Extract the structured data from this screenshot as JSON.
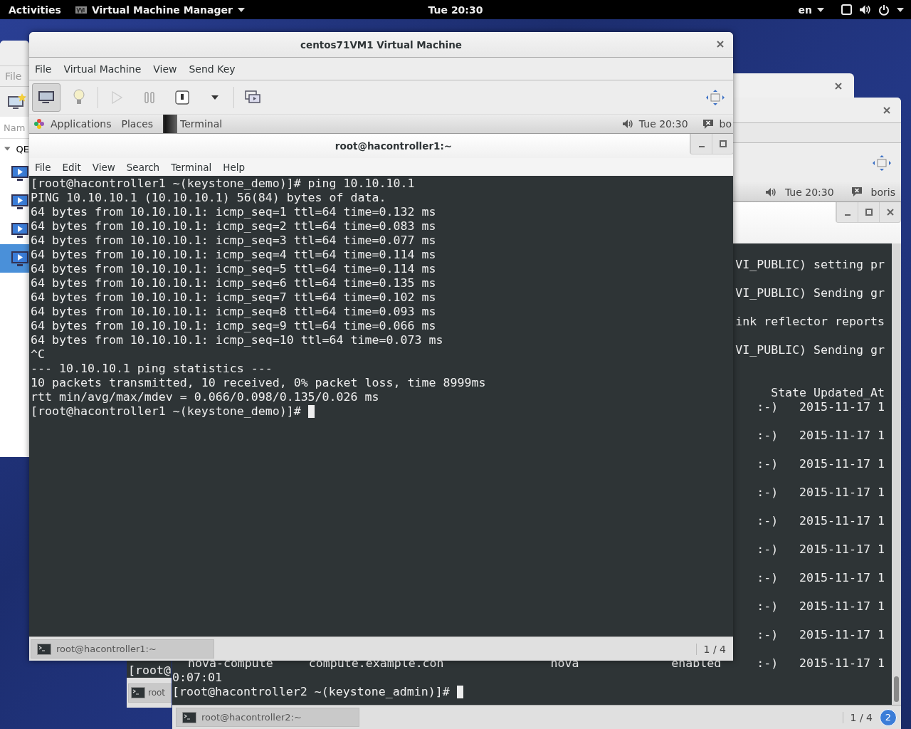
{
  "top_bar": {
    "activities": "Activities",
    "app_menu": "Virtual Machine Manager",
    "clock": "Tue 20:30",
    "input_source": "en"
  },
  "manager_window": {
    "menu": [
      "File"
    ],
    "column_header": "Nam",
    "group": {
      "label": "QE",
      "expanded": true
    },
    "vms": [
      {
        "selected": false
      },
      {
        "selected": false
      },
      {
        "selected": false
      },
      {
        "selected": true
      }
    ]
  },
  "vm_window_2": {
    "guest_panel": {
      "clock": "Tue 20:30",
      "user": "boris"
    },
    "terminal": {
      "lines": [
        {
          "kind": "log",
          "text": "VI_PUBLIC) setting pr"
        },
        {
          "kind": "log",
          "text": "VI_PUBLIC) Sending gr"
        },
        {
          "kind": "log",
          "text": "ink reflector reports"
        },
        {
          "kind": "log",
          "text": "VI_PUBLIC) Sending gr"
        },
        {
          "kind": "header",
          "text": "State Updated_At"
        },
        {
          "kind": "row",
          "text": ":-)   2015-11-17 1"
        },
        {
          "kind": "row",
          "text": ":-)   2015-11-17 1"
        },
        {
          "kind": "row",
          "text": ":-)   2015-11-17 1"
        },
        {
          "kind": "row",
          "text": ":-)   2015-11-17 1"
        },
        {
          "kind": "row",
          "text": ":-)   2015-11-17 1"
        },
        {
          "kind": "row",
          "text": ":-)   2015-11-17 1"
        },
        {
          "kind": "row",
          "text": ":-)   2015-11-17 1"
        },
        {
          "kind": "row",
          "text": ":-)   2015-11-17 1"
        },
        {
          "kind": "row",
          "text": ":-)   2015-11-17 1"
        },
        {
          "kind": "wide",
          "text": "nova-compute     compute.example.con               nova             enabled     :-)   2015-11-17 1"
        },
        {
          "kind": "plain",
          "text": "0:07:01"
        }
      ],
      "prompt": "[root@hacontroller2 ~(keystone_admin)]# "
    },
    "taskbar": {
      "item": "root@hacontroller2:~",
      "workspace": "1 / 4",
      "badge": "2"
    }
  },
  "vm_window_3": {
    "terminal_line": "[root@",
    "taskbar_item": "root"
  },
  "vm_window_1": {
    "title": "centos71VM1 Virtual Machine",
    "menu": [
      "File",
      "Virtual Machine",
      "View",
      "Send Key"
    ],
    "view_buttons": [
      {
        "kind": "console",
        "selected": true
      },
      {
        "kind": "details",
        "selected": false
      }
    ],
    "action_buttons": [
      {
        "kind": "run",
        "disabled": true
      },
      {
        "kind": "pause",
        "disabled": false
      },
      {
        "kind": "shutdown",
        "disabled": false
      },
      {
        "kind": "shutdown-menu",
        "disabled": false
      },
      {
        "kind": "snapshots",
        "disabled": false
      }
    ],
    "guest_panel": {
      "applications": "Applications",
      "places": "Places",
      "window_list": [
        "Terminal"
      ],
      "clock": "Tue 20:30",
      "user": "bo"
    },
    "terminal": {
      "title": "root@hacontroller1:~",
      "menu": [
        "File",
        "Edit",
        "View",
        "Search",
        "Terminal",
        "Help"
      ],
      "lines": [
        "[root@hacontroller1 ~(keystone_demo)]# ping 10.10.10.1",
        "PING 10.10.10.1 (10.10.10.1) 56(84) bytes of data.",
        "64 bytes from 10.10.10.1: icmp_seq=1 ttl=64 time=0.132 ms",
        "64 bytes from 10.10.10.1: icmp_seq=2 ttl=64 time=0.083 ms",
        "64 bytes from 10.10.10.1: icmp_seq=3 ttl=64 time=0.077 ms",
        "64 bytes from 10.10.10.1: icmp_seq=4 ttl=64 time=0.114 ms",
        "64 bytes from 10.10.10.1: icmp_seq=5 ttl=64 time=0.114 ms",
        "64 bytes from 10.10.10.1: icmp_seq=6 ttl=64 time=0.135 ms",
        "64 bytes from 10.10.10.1: icmp_seq=7 ttl=64 time=0.102 ms",
        "64 bytes from 10.10.10.1: icmp_seq=8 ttl=64 time=0.093 ms",
        "64 bytes from 10.10.10.1: icmp_seq=9 ttl=64 time=0.066 ms",
        "64 bytes from 10.10.10.1: icmp_seq=10 ttl=64 time=0.073 ms",
        "^C",
        "--- 10.10.10.1 ping statistics ---",
        "10 packets transmitted, 10 received, 0% packet loss, time 8999ms",
        "rtt min/avg/max/mdev = 0.066/0.098/0.135/0.026 ms"
      ],
      "prompt": "[root@hacontroller1 ~(keystone_demo)]# "
    },
    "taskbar": {
      "item": "root@hacontroller1:~",
      "workspace": "1 / 4"
    }
  }
}
